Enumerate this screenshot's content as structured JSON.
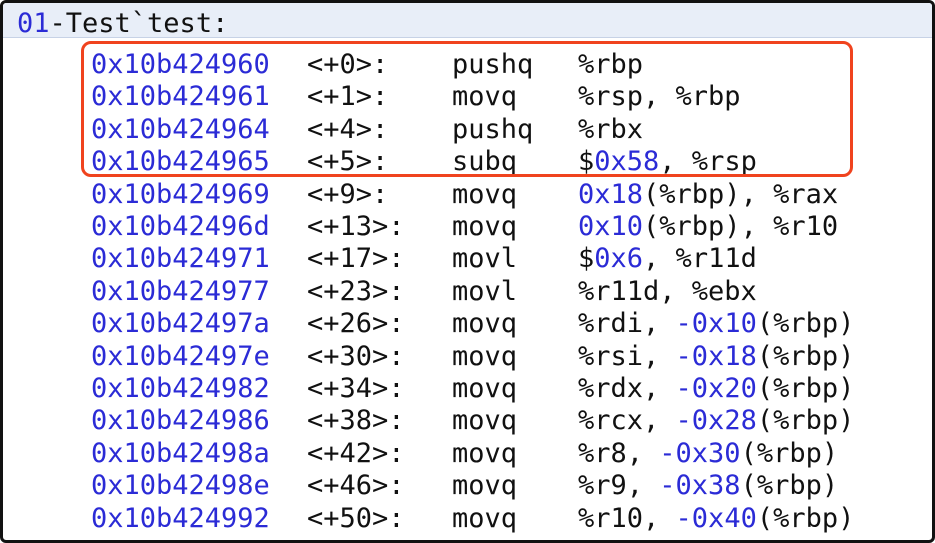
{
  "frame_title": {
    "prefix": "01",
    "rest": "-Test`test:"
  },
  "instructions": [
    {
      "address": "0x10b424960",
      "offset": "<+0>:",
      "mnemonic": "pushq",
      "operands": [
        {
          "t": "%rbp",
          "c": "p"
        }
      ]
    },
    {
      "address": "0x10b424961",
      "offset": "<+1>:",
      "mnemonic": "movq",
      "operands": [
        {
          "t": "%rsp, %rbp",
          "c": "p"
        }
      ]
    },
    {
      "address": "0x10b424964",
      "offset": "<+4>:",
      "mnemonic": "pushq",
      "operands": [
        {
          "t": "%rbx",
          "c": "p"
        }
      ]
    },
    {
      "address": "0x10b424965",
      "offset": "<+5>:",
      "mnemonic": "subq",
      "operands": [
        {
          "t": "$",
          "c": "p"
        },
        {
          "t": "0x58",
          "c": "n"
        },
        {
          "t": ", %rsp",
          "c": "p"
        }
      ]
    },
    {
      "address": "0x10b424969",
      "offset": "<+9>:",
      "mnemonic": "movq",
      "operands": [
        {
          "t": "0x18",
          "c": "n"
        },
        {
          "t": "(%rbp), %rax",
          "c": "p"
        }
      ]
    },
    {
      "address": "0x10b42496d",
      "offset": "<+13>:",
      "mnemonic": "movq",
      "operands": [
        {
          "t": "0x10",
          "c": "n"
        },
        {
          "t": "(%rbp), %r10",
          "c": "p"
        }
      ]
    },
    {
      "address": "0x10b424971",
      "offset": "<+17>:",
      "mnemonic": "movl",
      "operands": [
        {
          "t": "$",
          "c": "p"
        },
        {
          "t": "0x6",
          "c": "n"
        },
        {
          "t": ", %r11d",
          "c": "p"
        }
      ]
    },
    {
      "address": "0x10b424977",
      "offset": "<+23>:",
      "mnemonic": "movl",
      "operands": [
        {
          "t": "%r11d, %ebx",
          "c": "p"
        }
      ]
    },
    {
      "address": "0x10b42497a",
      "offset": "<+26>:",
      "mnemonic": "movq",
      "operands": [
        {
          "t": "%rdi, ",
          "c": "p"
        },
        {
          "t": "-0x10",
          "c": "n"
        },
        {
          "t": "(%rbp)",
          "c": "p"
        }
      ]
    },
    {
      "address": "0x10b42497e",
      "offset": "<+30>:",
      "mnemonic": "movq",
      "operands": [
        {
          "t": "%rsi, ",
          "c": "p"
        },
        {
          "t": "-0x18",
          "c": "n"
        },
        {
          "t": "(%rbp)",
          "c": "p"
        }
      ]
    },
    {
      "address": "0x10b424982",
      "offset": "<+34>:",
      "mnemonic": "movq",
      "operands": [
        {
          "t": "%rdx, ",
          "c": "p"
        },
        {
          "t": "-0x20",
          "c": "n"
        },
        {
          "t": "(%rbp)",
          "c": "p"
        }
      ]
    },
    {
      "address": "0x10b424986",
      "offset": "<+38>:",
      "mnemonic": "movq",
      "operands": [
        {
          "t": "%rcx, ",
          "c": "p"
        },
        {
          "t": "-0x28",
          "c": "n"
        },
        {
          "t": "(%rbp)",
          "c": "p"
        }
      ]
    },
    {
      "address": "0x10b42498a",
      "offset": "<+42>:",
      "mnemonic": "movq",
      "operands": [
        {
          "t": "%r8, ",
          "c": "p"
        },
        {
          "t": "-0x30",
          "c": "n"
        },
        {
          "t": "(%rbp)",
          "c": "p"
        }
      ]
    },
    {
      "address": "0x10b42498e",
      "offset": "<+46>:",
      "mnemonic": "movq",
      "operands": [
        {
          "t": "%r9, ",
          "c": "p"
        },
        {
          "t": "-0x38",
          "c": "n"
        },
        {
          "t": "(%rbp)",
          "c": "p"
        }
      ]
    },
    {
      "address": "0x10b424992",
      "offset": "<+50>:",
      "mnemonic": "movq",
      "operands": [
        {
          "t": "%r10, ",
          "c": "p"
        },
        {
          "t": "-0x40",
          "c": "n"
        },
        {
          "t": "(%rbp)",
          "c": "p"
        }
      ]
    }
  ],
  "highlight": {
    "first_index": 0,
    "last_index": 3,
    "color": "#f0431e"
  },
  "colors": {
    "address": "#2b2bd6",
    "text": "#111111",
    "header_bg": "#e8eef8"
  }
}
